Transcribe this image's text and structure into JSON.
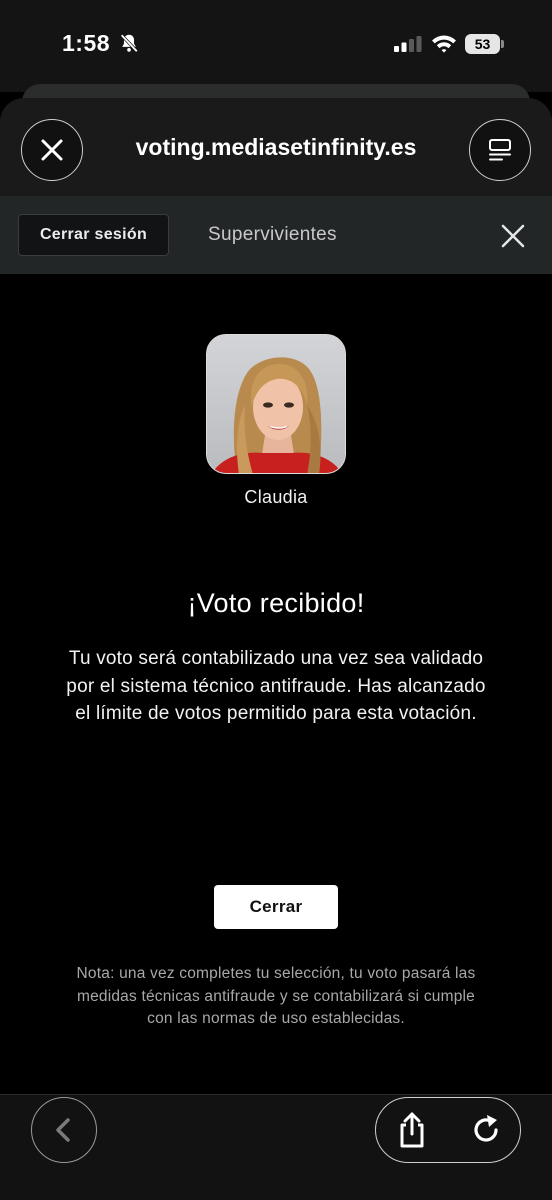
{
  "status_bar": {
    "time": "1:58",
    "battery": "53",
    "icons": [
      "bell-muted-icon",
      "signal-icon",
      "wifi-icon",
      "battery-icon"
    ]
  },
  "browser": {
    "url": "voting.mediasetinfinity.es",
    "close_icon": "close-icon",
    "reader_icon": "reader-mode-icon",
    "bottom_icons": [
      "back-icon",
      "share-icon",
      "reload-icon"
    ]
  },
  "site_nav": {
    "logout_label": "Cerrar sesión",
    "section_label": "Supervivientes",
    "close_icon": "close-icon"
  },
  "vote": {
    "contestant_name": "Claudia",
    "title": "¡Voto recibido!",
    "message": "Tu voto será contabilizado una vez sea validado por el sistema técnico antifraude. Has alcanzado el límite de votos permitido para esta votación.",
    "close_button": "Cerrar",
    "note": "Nota: una vez completes tu selección, tu voto pasará las medidas técnicas antifraude y se contabilizará si cumple con las normas de uso establecidas."
  },
  "colors": {
    "background": "#000000",
    "nav_bar": "#222627",
    "url_bar": "#1a1a1a",
    "primary_button": "#ffffff",
    "note_text": "#a8a8a8"
  }
}
